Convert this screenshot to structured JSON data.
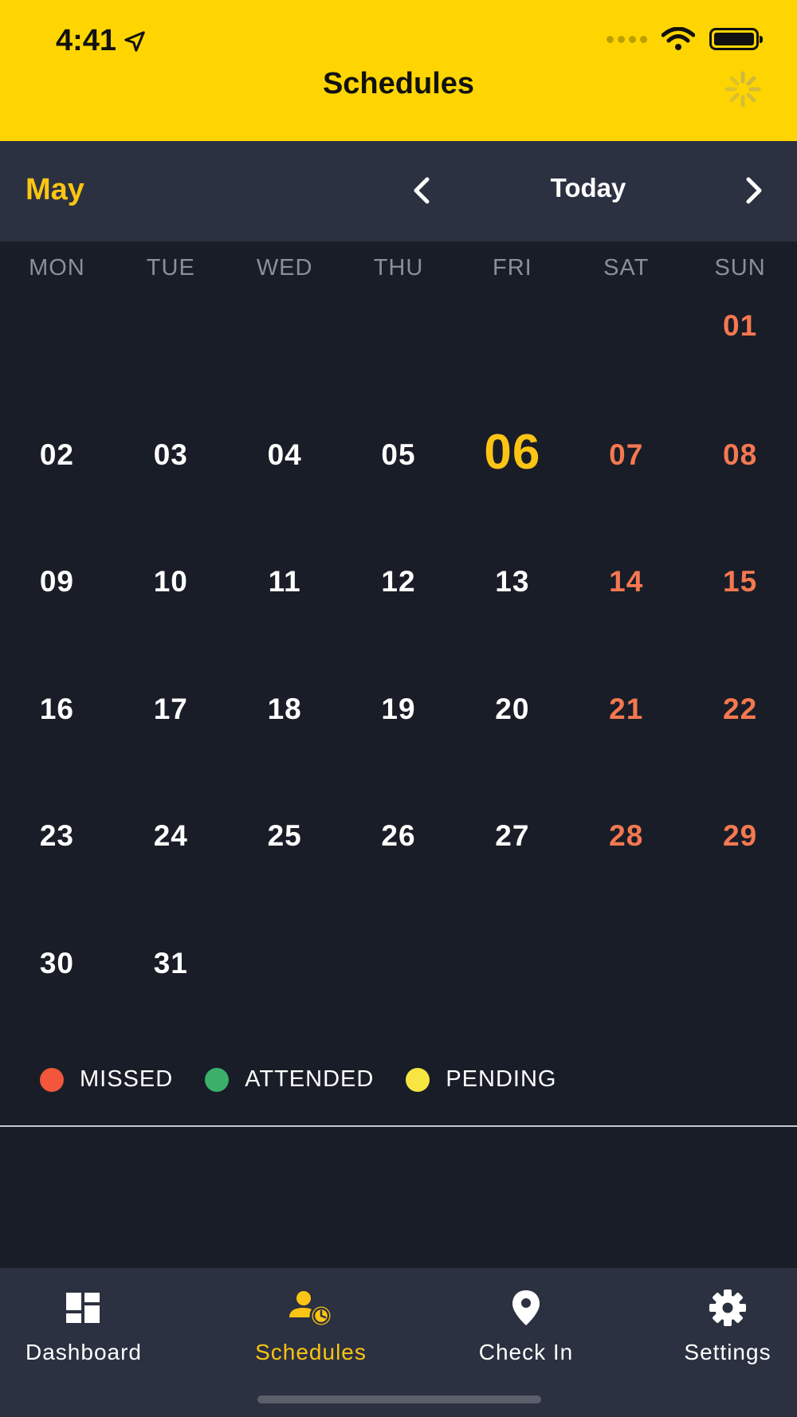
{
  "status_bar": {
    "time": "4:41"
  },
  "header": {
    "title": "Schedules"
  },
  "calendar": {
    "month": "May",
    "today_label": "Today",
    "weekdays": [
      "MON",
      "TUE",
      "WED",
      "THU",
      "FRI",
      "SAT",
      "SUN"
    ],
    "weeks": [
      [
        "",
        "",
        "",
        "",
        "",
        "",
        "01"
      ],
      [
        "02",
        "03",
        "04",
        "05",
        "06",
        "07",
        "08"
      ],
      [
        "09",
        "10",
        "11",
        "12",
        "13",
        "14",
        "15"
      ],
      [
        "16",
        "17",
        "18",
        "19",
        "20",
        "21",
        "22"
      ],
      [
        "23",
        "24",
        "25",
        "26",
        "27",
        "28",
        "29"
      ],
      [
        "30",
        "31",
        "",
        "",
        "",
        "",
        ""
      ]
    ],
    "today": "06"
  },
  "legend": [
    {
      "label": "MISSED",
      "color": "#f2573b"
    },
    {
      "label": "ATTENDED",
      "color": "#3ab06a"
    },
    {
      "label": "PENDING",
      "color": "#f7e541"
    }
  ],
  "tabs": [
    {
      "label": "Dashboard",
      "icon": "dashboard-icon",
      "active": false
    },
    {
      "label": "Schedules",
      "icon": "user-clock-icon",
      "active": true
    },
    {
      "label": "Check In",
      "icon": "location-pin-icon",
      "active": false
    },
    {
      "label": "Settings",
      "icon": "gear-icon",
      "active": false
    }
  ],
  "colors": {
    "brand_yellow": "#fed501",
    "accent_yellow": "#fcc414",
    "weekend": "#f57850",
    "background": "#191d28",
    "bar": "#2b3140"
  }
}
